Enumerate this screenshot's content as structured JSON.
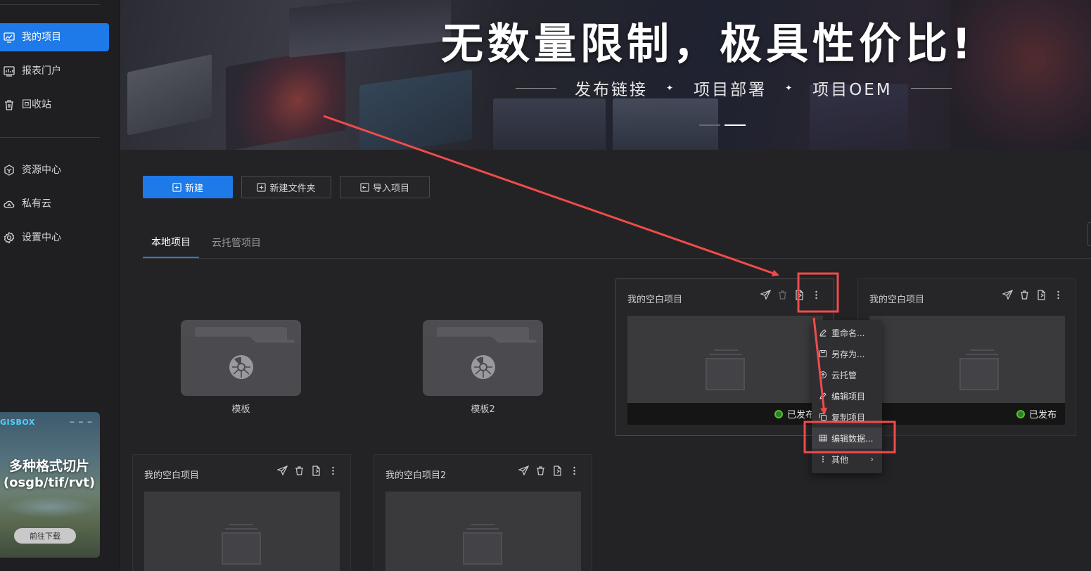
{
  "sidebar": {
    "items": [
      {
        "label": "我的项目",
        "icon": "chart-monitor-icon",
        "active": true
      },
      {
        "label": "报表门户",
        "icon": "report-icon"
      },
      {
        "label": "回收站",
        "icon": "trash-icon"
      },
      {
        "label": "资源中心",
        "icon": "cube-icon"
      },
      {
        "label": "私有云",
        "icon": "cloud-icon"
      },
      {
        "label": "设置中心",
        "icon": "gear-icon"
      }
    ],
    "ad": {
      "logo": "GISBOX",
      "line1": "多种格式切片",
      "line2": "(osgb/tif/rvt)",
      "button": "前往下载"
    }
  },
  "banner": {
    "title": "无数量限制，极具性价比!",
    "features": [
      "发布链接",
      "项目部署",
      "项目OEM"
    ],
    "carousel_count": 2,
    "carousel_active": 1
  },
  "toolbar": {
    "new_label": "新建",
    "new_folder_label": "新建文件夹",
    "import_label": "导入项目"
  },
  "tabs": [
    {
      "label": "本地项目",
      "active": true
    },
    {
      "label": "云托管项目",
      "active": false
    }
  ],
  "folders": [
    {
      "name": "模板"
    },
    {
      "name": "模板2"
    }
  ],
  "projects": [
    {
      "name": "我的空白项目",
      "status": "已发布",
      "published": true
    },
    {
      "name": "我的空白项目",
      "status": "已发布",
      "published": true
    },
    {
      "name": "我的空白项目",
      "published": false
    },
    {
      "name": "我的空白项目2",
      "published": false
    }
  ],
  "context_menu": {
    "items": [
      {
        "label": "重命名...",
        "icon": "pencil-icon"
      },
      {
        "label": "另存为...",
        "icon": "save-icon"
      },
      {
        "label": "云托管",
        "icon": "cloud-upload-icon"
      },
      {
        "label": "编辑项目",
        "icon": "edit-icon"
      },
      {
        "label": "复制项目",
        "icon": "copy-icon"
      },
      {
        "label": "编辑数据...",
        "icon": "table-icon",
        "highlighted": true
      },
      {
        "label": "其他",
        "icon": "more-vertical-icon",
        "submenu": true
      }
    ]
  },
  "colors": {
    "accent": "#1e7ae8",
    "annotation": "#f04b4b",
    "published": "#52c41a"
  }
}
